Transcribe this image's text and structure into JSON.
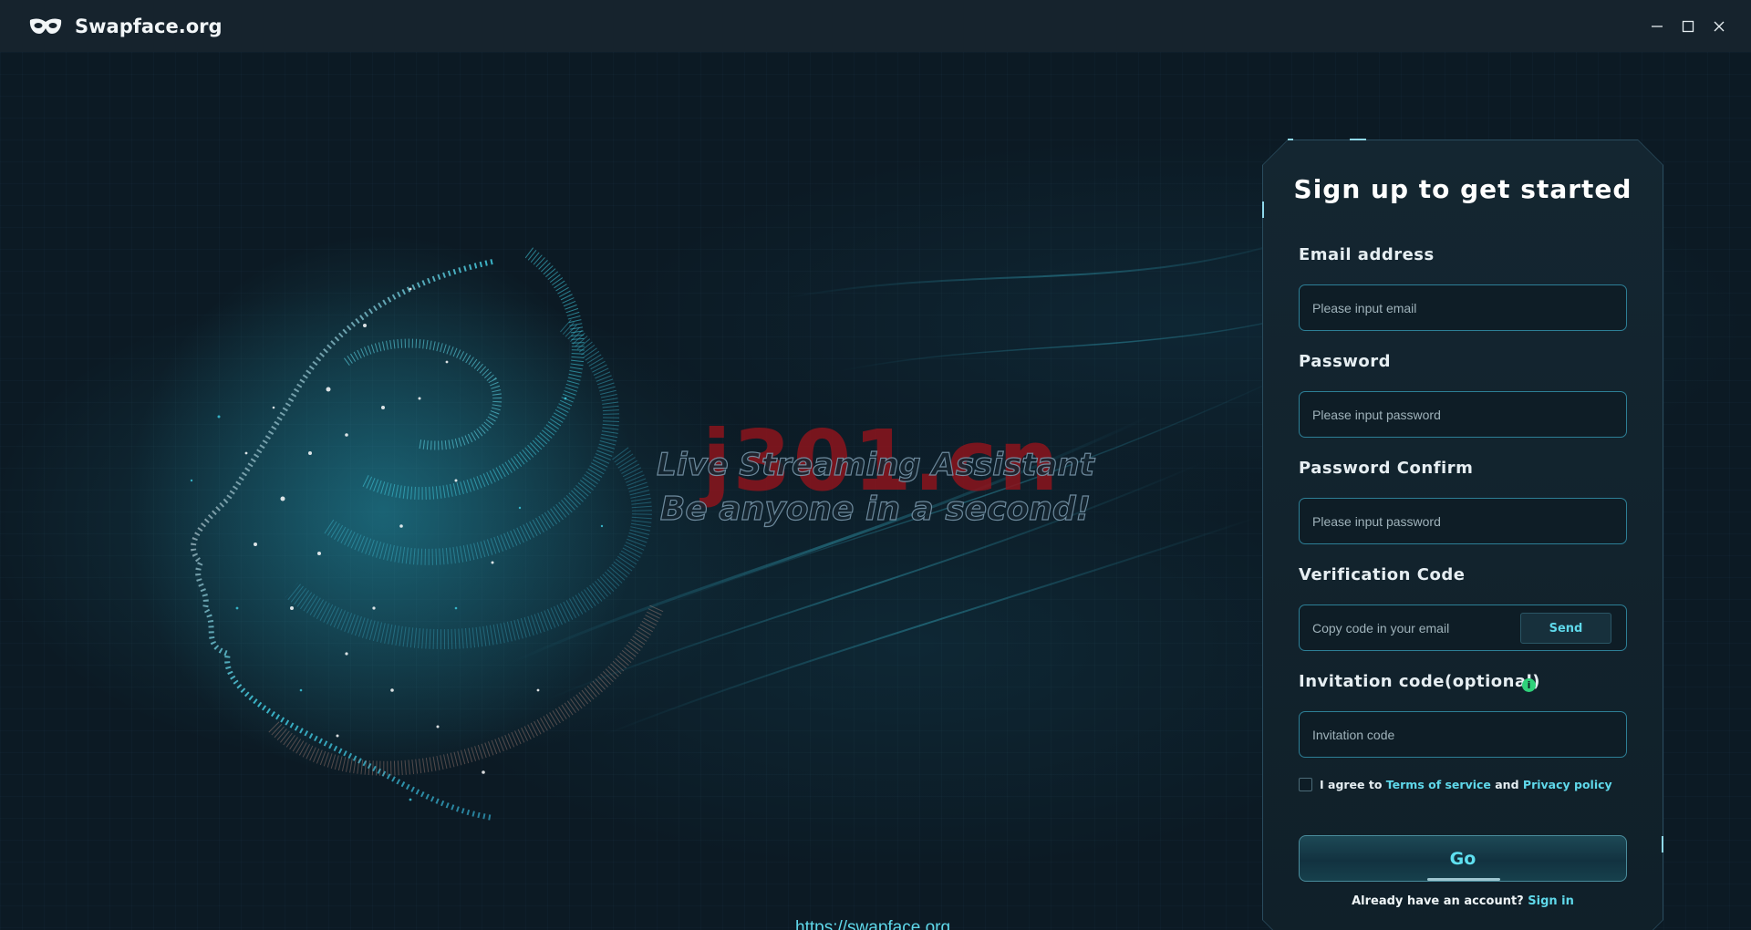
{
  "window": {
    "title": "Swapface.org",
    "controls": {
      "minimize": "minimize-icon",
      "maximize": "maximize-icon",
      "close": "close-icon"
    }
  },
  "hero": {
    "watermark": "j301.cn",
    "tagline_line1": "Live Streaming Assistant",
    "tagline_line2": "Be anyone in a second!",
    "url": "https://swapface.org"
  },
  "signup": {
    "title": "Sign up to get started",
    "email_label": "Email address",
    "email_placeholder": "Please input email",
    "password_label": "Password",
    "password_placeholder": "Please input password",
    "confirm_label": "Password Confirm",
    "confirm_placeholder": "Please input password",
    "code_label": "Verification Code",
    "code_placeholder": "Copy code in your email",
    "send_label": "Send",
    "invite_label": "Invitation code(optional)",
    "invite_placeholder": "Invitation code",
    "invite_info_icon": "i",
    "agree_prefix": "I agree to",
    "terms_link": "Terms of service",
    "agree_and": "and",
    "privacy_link": "Privacy policy",
    "go_label": "Go",
    "signin_prompt": "Already have an account?",
    "signin_link": "Sign in"
  },
  "colors": {
    "accent": "#5fd8ea",
    "background": "#0c1a24",
    "input_border": "#2d7f96",
    "info_green": "#2fd17a"
  }
}
